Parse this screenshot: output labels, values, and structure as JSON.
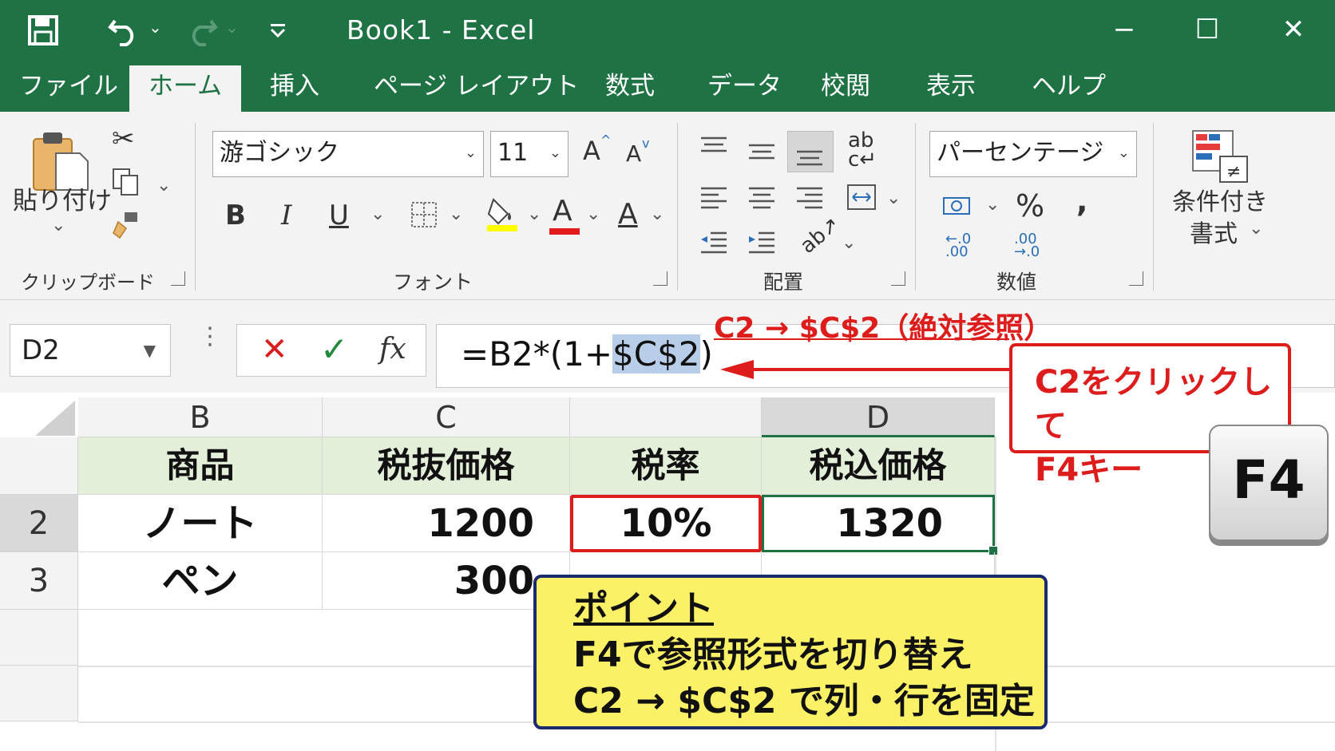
{
  "title_bar": {
    "title": "Book1  -  Excel",
    "save_icon": "save-icon",
    "undo_icon": "undo-icon",
    "redo_icon": "redo-icon",
    "qat_icon": "customize-qat-icon",
    "minimize": "−",
    "maximize": "☐",
    "close": "✕"
  },
  "tabs": [
    {
      "label": "ファイル",
      "active": false
    },
    {
      "label": "ホーム",
      "active": true
    },
    {
      "label": "挿入",
      "active": false
    },
    {
      "label": "ページ レイアウト",
      "active": false
    },
    {
      "label": "数式",
      "active": false
    },
    {
      "label": "データ",
      "active": false
    },
    {
      "label": "校閲",
      "active": false
    },
    {
      "label": "表示",
      "active": false
    },
    {
      "label": "ヘルプ",
      "active": false
    }
  ],
  "ribbon": {
    "clipboard": {
      "paste_label": "貼り付け",
      "group_label": "クリップボード"
    },
    "font": {
      "font_name": "游ゴシック",
      "font_size": "11",
      "bold": "B",
      "italic": "I",
      "underline": "U",
      "grow": "A",
      "shrink": "A",
      "fill_color": "#ffff00",
      "font_color_value": "#e31b1b",
      "group_label": "フォント"
    },
    "alignment": {
      "group_label": "配置"
    },
    "number": {
      "format": "パーセンテージ",
      "percent": "%",
      "comma": ",",
      "group_label": "数値"
    },
    "styles": {
      "cond_format_line1": "条件付き",
      "cond_format_line2": "書式"
    }
  },
  "formula_bar": {
    "name_box": "D2",
    "cancel": "✕",
    "confirm": "✓",
    "fx": "fx",
    "formula_prefix": "=B2*(1+",
    "formula_selected": "$C$2",
    "formula_suffix": ")"
  },
  "grid": {
    "columns": [
      "B",
      "C",
      "",
      "D"
    ],
    "rows": [
      "2",
      "3"
    ],
    "header_row": [
      "商品",
      "税抜価格",
      "税率",
      "税込価格"
    ],
    "data": [
      [
        "ノート",
        "1200",
        "10%",
        "1320"
      ],
      [
        "ペン",
        "300",
        "",
        ""
      ]
    ]
  },
  "annotations": {
    "top_label": "C2 → $C$2（絶対参照）",
    "callout_line1": "C2をクリックして",
    "callout_line2": "F4キー",
    "key_label": "F4",
    "point_title": "ポイント",
    "point_line1": "F4で参照形式を切り替え",
    "point_line2": "C2 → $C$2 で列・行を固定"
  },
  "colors": {
    "excel_green": "#1f7244",
    "annotation_red": "#dd1c1c",
    "point_yellow": "#fbf166",
    "header_fill": "#e3efd9"
  }
}
